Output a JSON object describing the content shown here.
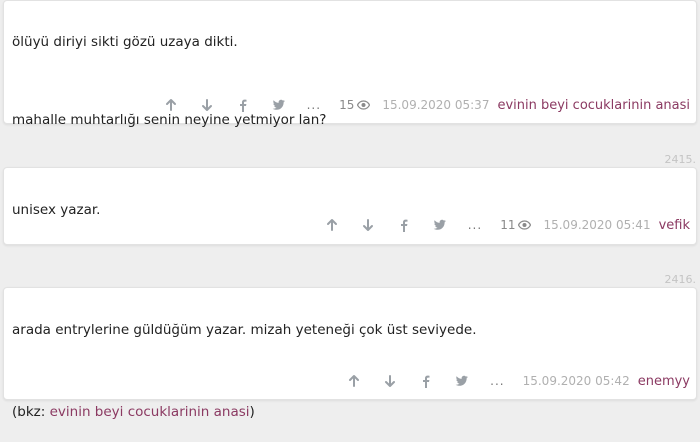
{
  "entries": [
    {
      "lines": [
        "ölüyü diriyi sikti gözü uzaya dikti.",
        "mahalle muhtarlığı senin neyine yetmiyor lan?"
      ],
      "views": "15",
      "date": "15.09.2020 05:37",
      "author": "evinin beyi cocuklarinin anasi"
    },
    {
      "number": "2415.",
      "lines": [
        "unisex yazar."
      ],
      "views": "11",
      "date": "15.09.2020 05:41",
      "author": "vefik"
    },
    {
      "number": "2416.",
      "lines": [
        "arada entrylerine güldüğüm yazar. mizah yeteneği çok üst seviyede."
      ],
      "bkz_prefix": "(bkz: ",
      "bkz_link": "evinin beyi cocuklarinin anasi",
      "bkz_suffix": ")",
      "date": "15.09.2020 05:42",
      "author": "enemyy"
    }
  ],
  "icons": [
    "upvote-icon",
    "downvote-icon",
    "facebook-icon",
    "twitter-icon"
  ],
  "more_label": "...",
  "colors": {
    "accent": "#8b3a62",
    "background": "#eeeeee",
    "muted": "#a3a3a3"
  }
}
